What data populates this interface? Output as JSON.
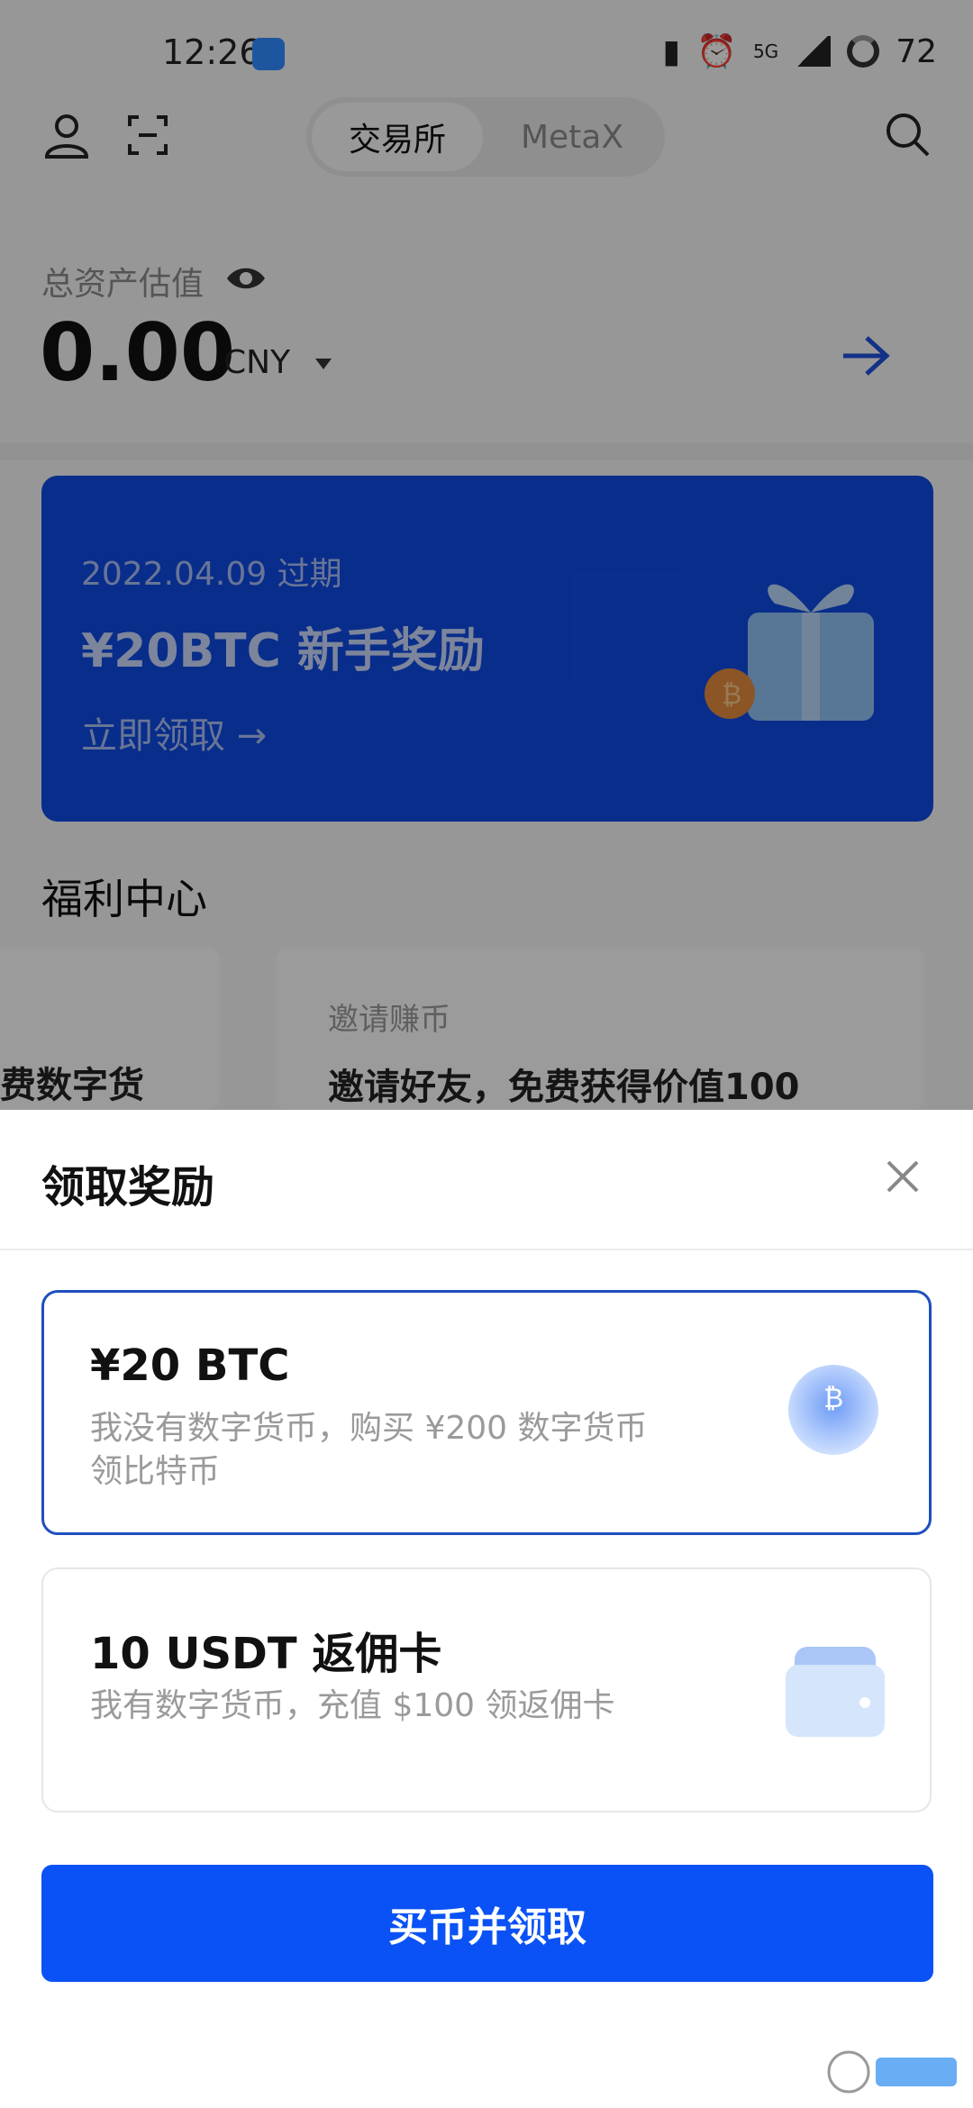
{
  "status_bar": {
    "time": "12:26",
    "network": "5G",
    "battery": "72"
  },
  "nav": {
    "segments": [
      "交易所",
      "MetaX"
    ],
    "active_segment": "交易所"
  },
  "assets": {
    "label": "总资产估值",
    "value": "0.00",
    "currency": "CNY"
  },
  "banner": {
    "date": "2022.04.09 过期",
    "title": "¥20BTC 新手奖励",
    "link": "立即领取 →"
  },
  "welfare": {
    "section_title": "福利中心",
    "left_card_text": "费数字货",
    "right_card_tag": "邀请赚币",
    "right_card_desc": "邀请好友，免费获得价值100"
  },
  "sheet": {
    "title": "领取奖励",
    "options": [
      {
        "title": "¥20 BTC",
        "desc": "我没有数字货币，购买 ¥200 数字货币领比特币",
        "selected": true
      },
      {
        "title": "10 USDT 返佣卡",
        "desc": "我有数字货币，充值 $100 领返佣卡",
        "selected": false
      }
    ],
    "button": "买币并领取"
  },
  "colors": {
    "primary": "#0a52f5",
    "banner_bg": "#0f4ae0",
    "selected_border": "#1f4fbf"
  }
}
